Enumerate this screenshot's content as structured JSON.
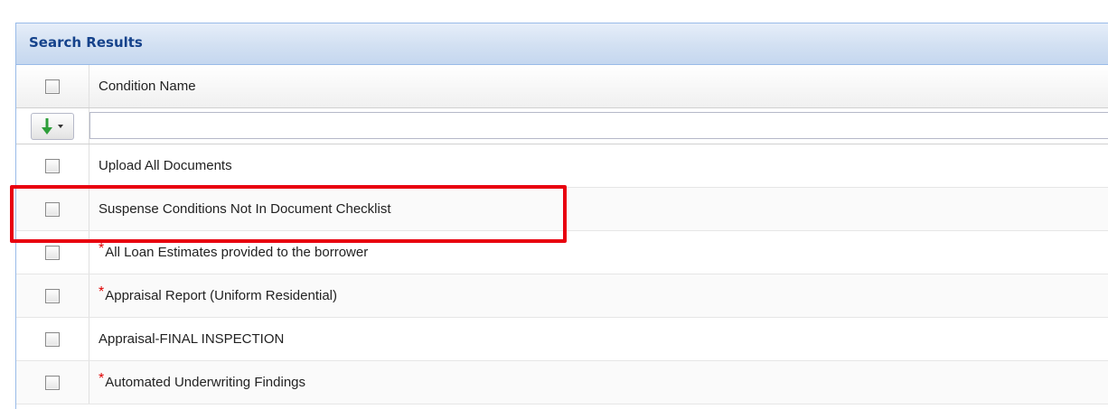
{
  "panel": {
    "title": "Search Results"
  },
  "grid": {
    "column_header": "Condition Name",
    "filter": {
      "value": "",
      "sort_icon": "sort-arrow-down-icon"
    },
    "rows": [
      {
        "name": "Upload All Documents",
        "required": false
      },
      {
        "name": "Suspense Conditions Not In Document Checklist",
        "required": false,
        "highlighted": true
      },
      {
        "name": "All Loan Estimates provided to the borrower",
        "required": true
      },
      {
        "name": "Appraisal Report (Uniform Residential)",
        "required": true
      },
      {
        "name": "Appraisal-FINAL INSPECTION",
        "required": false
      },
      {
        "name": "Automated Underwriting Findings",
        "required": true
      }
    ],
    "required_marker": "*"
  },
  "colors": {
    "highlight": "#e8000f",
    "title": "#15428b",
    "required": "#e00000",
    "arrow": "#2e9e3a"
  }
}
